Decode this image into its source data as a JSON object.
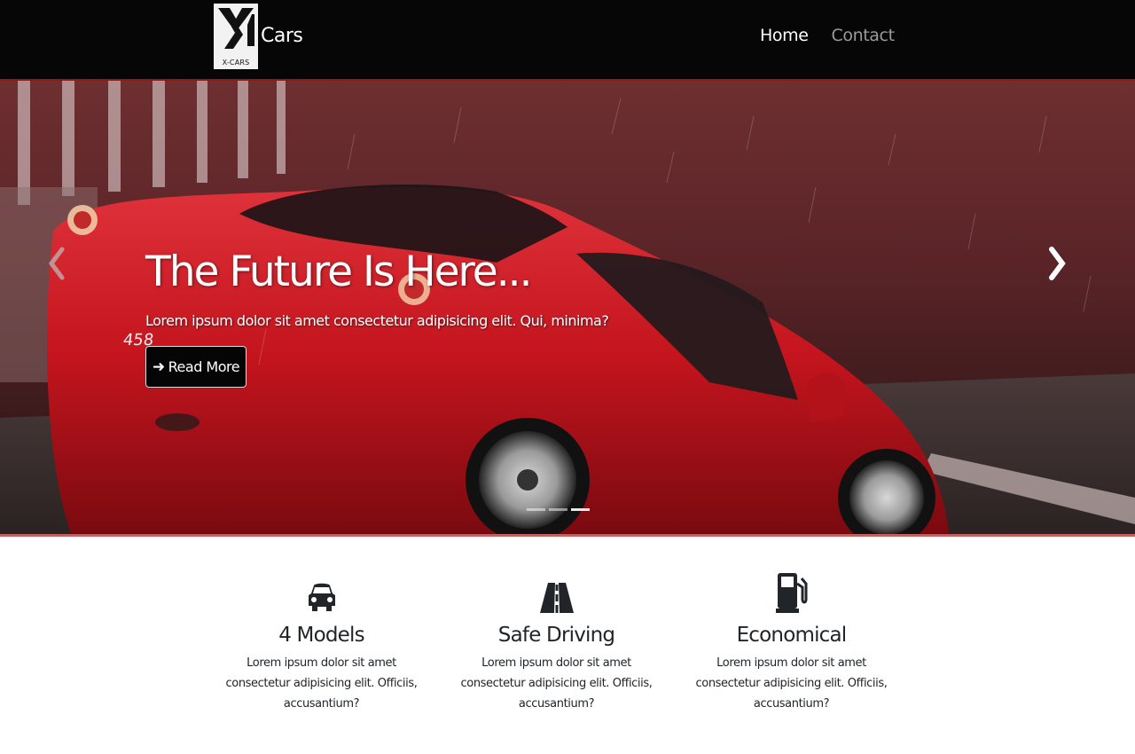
{
  "navbar": {
    "logo_text": "X-CARS",
    "brand": "Cars",
    "links": [
      {
        "label": "Home",
        "active": true
      },
      {
        "label": "Contact",
        "active": false
      }
    ]
  },
  "hero": {
    "title": "The Future Is Here...",
    "subtitle": "Lorem ipsum dolor sit amet consectetur adipisicing elit. Qui, minima?",
    "button_label": "Read More",
    "button_icon": "arrow-right-icon",
    "slide_count": 3,
    "active_slide": 1,
    "car_plate": "458"
  },
  "features": [
    {
      "icon": "car-icon",
      "title": "4 Models",
      "text": "Lorem ipsum dolor sit amet consectetur adipisicing elit. Officiis, accusantium?"
    },
    {
      "icon": "road-icon",
      "title": "Safe Driving",
      "text": "Lorem ipsum dolor sit amet consectetur adipisicing elit. Officiis, accusantium?"
    },
    {
      "icon": "gas-pump-icon",
      "title": "Economical",
      "text": "Lorem ipsum dolor sit amet consectetur adipisicing elit. Officiis, accusantium?"
    }
  ],
  "colors": {
    "navbar_bg": "#060606",
    "accent_red": "#d3121b",
    "hero_bg": "#5a2427",
    "text_dark": "#212529"
  }
}
